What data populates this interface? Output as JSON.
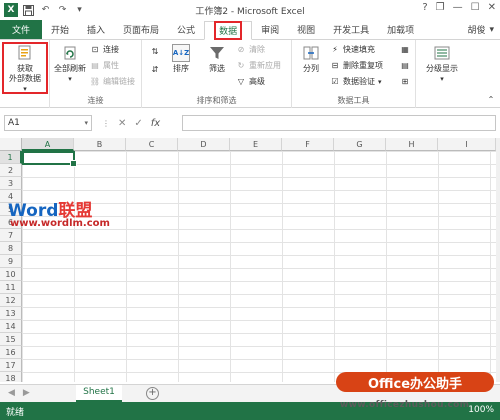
{
  "app": {
    "title": "工作簿2 - Microsoft Excel",
    "logo_letter": "X",
    "user": "胡俊"
  },
  "qat": {
    "save_icon": "save-icon",
    "undo_icon": "undo-icon",
    "redo_icon": "redo-icon"
  },
  "window_controls": {
    "help": "?",
    "restore": "❐",
    "minimize": "—",
    "maximize": "☐",
    "close": "✕"
  },
  "tabs": [
    {
      "label": "文件"
    },
    {
      "label": "开始"
    },
    {
      "label": "插入"
    },
    {
      "label": "页面布局"
    },
    {
      "label": "公式"
    },
    {
      "label": "数据"
    },
    {
      "label": "审阅"
    },
    {
      "label": "视图"
    },
    {
      "label": "开发工具"
    },
    {
      "label": "加载项"
    }
  ],
  "ribbon": {
    "get_external": {
      "line1": "获取",
      "line2": "外部数据"
    },
    "refresh_all": "全部刷新",
    "connections": "连接",
    "properties": "属性",
    "edit_links": "编辑链接",
    "group_connections": "连接",
    "sort_az": "A↓Z",
    "sort": "排序",
    "filter": "筛选",
    "clear": "清除",
    "reapply": "重新应用",
    "advanced": "高级",
    "group_sort_filter": "排序和筛选",
    "text_to_columns": "分列",
    "flash_fill": "快速填充",
    "remove_duplicates": "删除重复项",
    "data_validation": "数据验证",
    "group_data_tools": "数据工具",
    "outline": "分级显示"
  },
  "formula_bar": {
    "name_box": "A1",
    "cancel": "✕",
    "enter": "✓",
    "fx": "fx",
    "value": ""
  },
  "grid": {
    "columns": [
      "A",
      "B",
      "C",
      "D",
      "E",
      "F",
      "G",
      "H",
      "I"
    ],
    "rows": [
      "1",
      "2",
      "3",
      "4",
      "5",
      "6",
      "7",
      "8",
      "9",
      "10",
      "11",
      "12",
      "13",
      "14",
      "15",
      "16",
      "17",
      "18"
    ]
  },
  "watermarks": {
    "brand_w": "W",
    "brand_ord": "ord",
    "brand_cn": "联盟",
    "url": "www.wordlm.com",
    "office_cn": "Office办公助手",
    "office_url": "www.officezhushou.com"
  },
  "sheets": {
    "tab": "Sheet1",
    "add": "+"
  },
  "status": {
    "ready": "就绪",
    "zoom": "100%"
  },
  "colors": {
    "excel_green": "#217346",
    "highlight_red": "#e3262a"
  }
}
